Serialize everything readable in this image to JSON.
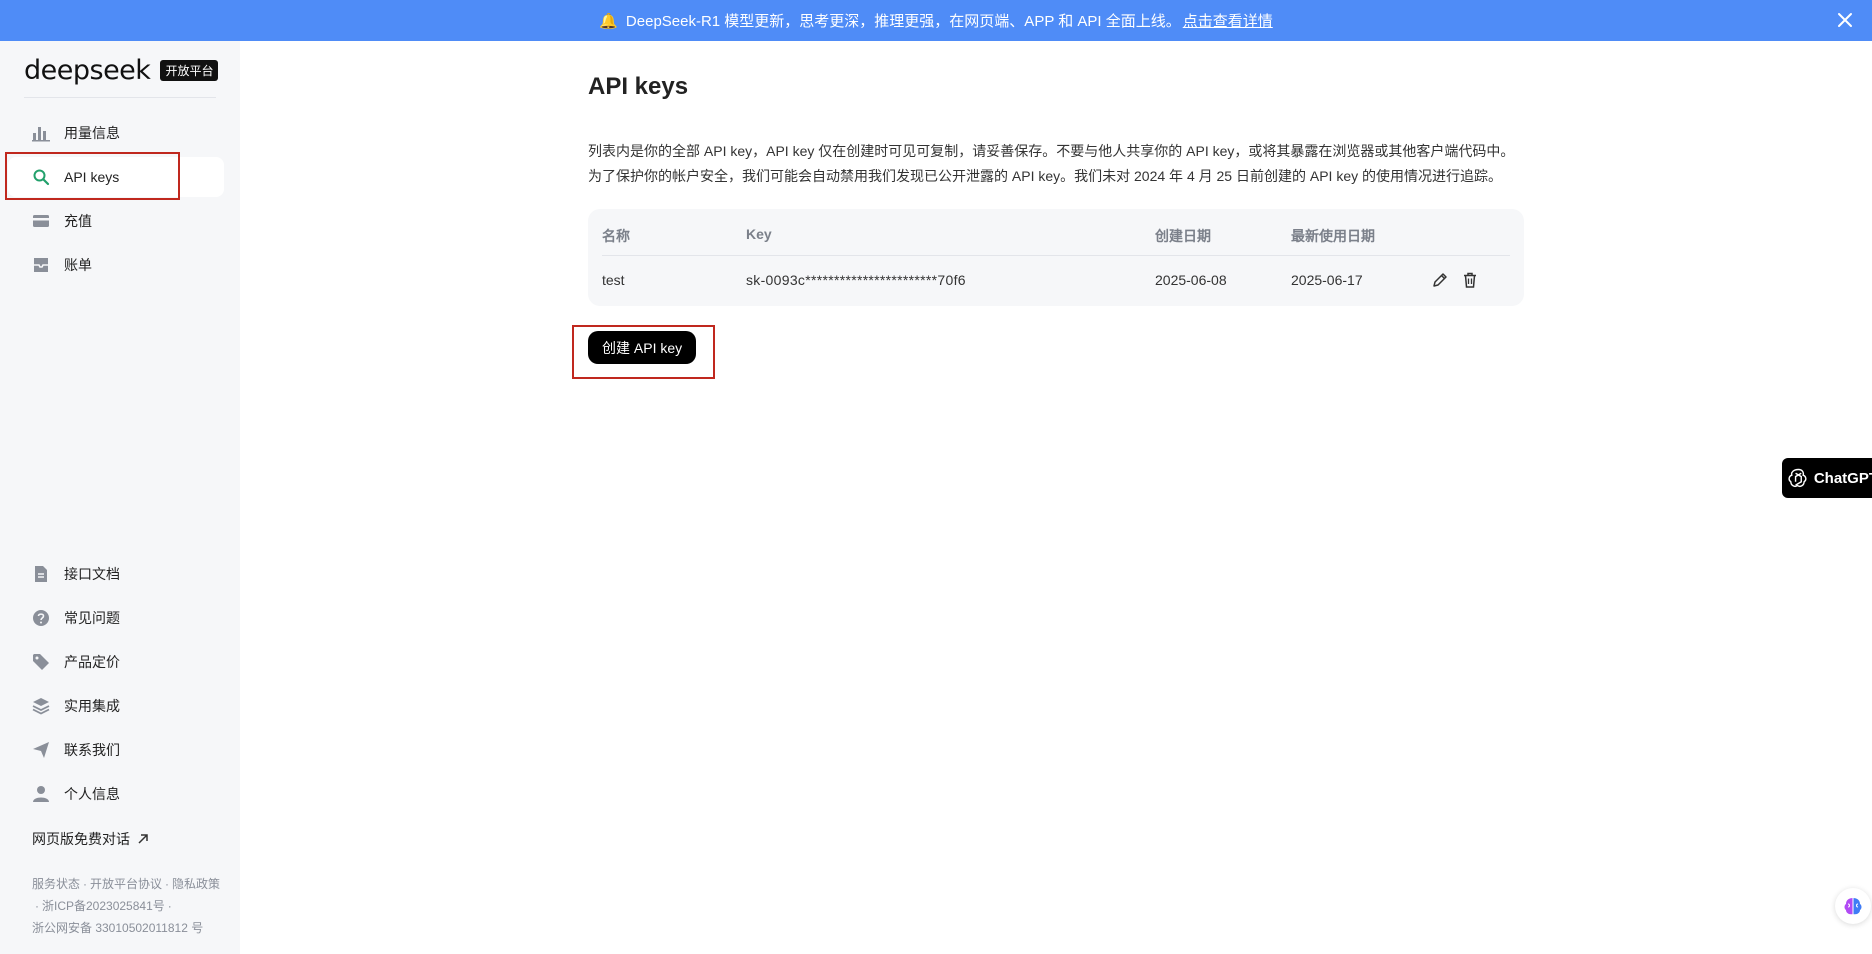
{
  "banner": {
    "bell_icon": "🔔",
    "message": "DeepSeek-R1 模型更新，思考更深，推理更强，在网页端、APP 和 API 全面上线。",
    "link": "点击查看详情"
  },
  "sidebar": {
    "logo": "deepseek",
    "badge": "开放平台",
    "top_items": [
      {
        "label": "用量信息",
        "icon": "bar-chart-icon"
      },
      {
        "label": "API keys",
        "icon": "search-key-icon"
      },
      {
        "label": "充值",
        "icon": "card-icon"
      },
      {
        "label": "账单",
        "icon": "bill-icon"
      }
    ],
    "bottom_items": [
      {
        "label": "接口文档",
        "icon": "document-icon"
      },
      {
        "label": "常见问题",
        "icon": "question-icon"
      },
      {
        "label": "产品定价",
        "icon": "tag-icon"
      },
      {
        "label": "实用集成",
        "icon": "layers-icon"
      },
      {
        "label": "联系我们",
        "icon": "send-icon"
      },
      {
        "label": "个人信息",
        "icon": "user-icon"
      }
    ],
    "free_chat": "网页版免费对话",
    "footer": {
      "status": "服务状态",
      "agreement": "开放平台协议",
      "privacy": "隐私政策",
      "icp": "浙ICP备2023025841号",
      "police": "浙公网安备 33010502011812 号"
    }
  },
  "main": {
    "title": "API keys",
    "desc_line1": "列表内是你的全部 API key，API key 仅在创建时可见可复制，请妥善保存。不要与他人共享你的 API key，或将其暴露在浏览器或其他客户端代码中。",
    "desc_line2": "为了保护你的帐户安全，我们可能会自动禁用我们发现已公开泄露的 API key。我们未对 2024 年 4 月 25 日前创建的 API key 的使用情况进行追踪。",
    "table": {
      "headers": [
        "名称",
        "Key",
        "创建日期",
        "最新使用日期"
      ],
      "rows": [
        {
          "name": "test",
          "key": "sk-0093c***********************70f6",
          "created": "2025-06-08",
          "last_used": "2025-06-17"
        }
      ]
    },
    "create_button": "创建 API key"
  },
  "floating": {
    "chatgpt_label": "ChatGPT"
  },
  "colors": {
    "banner_bg": "#4f8cf7",
    "sidebar_bg": "#f6f7f9",
    "highlight_border": "#c0281e",
    "active_icon": "#22a06b"
  }
}
